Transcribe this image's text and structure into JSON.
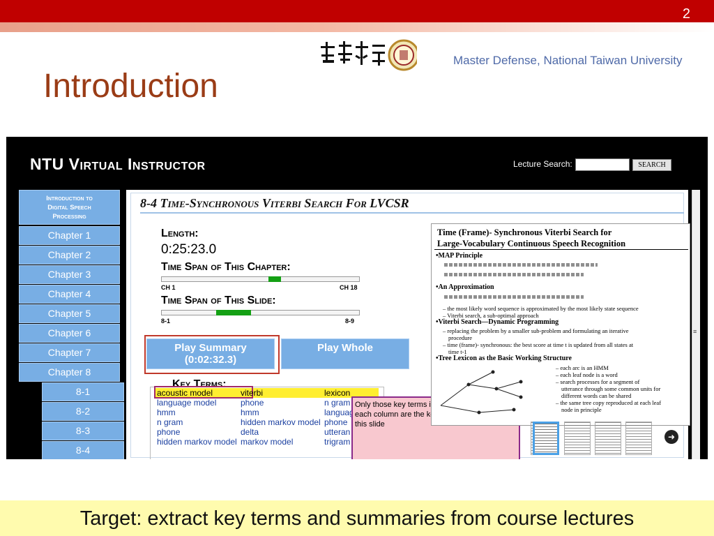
{
  "slide": {
    "number": "2",
    "header_text": "Master Defense, National Taiwan University",
    "title": "Introduction",
    "target_text": "Target: extract key terms and summaries from course lectures"
  },
  "app": {
    "title": "NTU Virtual Instructor",
    "search_label": "Lecture Search:",
    "search_button": "SEARCH"
  },
  "sidebar": {
    "intro_lines": [
      "Introduction to",
      "Digital Speech",
      "Processing"
    ],
    "chapters": [
      "Chapter 1",
      "Chapter 2",
      "Chapter 3",
      "Chapter 4",
      "Chapter 5",
      "Chapter 6",
      "Chapter 7",
      "Chapter 8"
    ],
    "subsections": [
      "8-1",
      "8-2",
      "8-3",
      "8-4"
    ]
  },
  "main": {
    "heading": "8-4 Time-Synchronous Viterbi Search For LVCSR",
    "length_label": "Length:",
    "length_value": "0:25:23.0",
    "chapter_span_label": "Time Span of This Chapter:",
    "chapter_span_start": "CH 1",
    "chapter_span_end": "CH 18",
    "slide_span_label": "Time Span of This Slide:",
    "slide_span_start": "8-1",
    "slide_span_end": "8-9",
    "play_summary_line1": "Play Summary",
    "play_summary_line2": "(0:02:32.3)",
    "play_whole": "Play Whole",
    "key_terms_label": "Key Terms:",
    "key_terms_columns": [
      [
        "acoustic model",
        "language model",
        "hmm",
        "n gram",
        "phone",
        "hidden markov model"
      ],
      [
        "viterbi",
        "phone",
        "hmm",
        "hidden markov model",
        "delta",
        "markov model"
      ],
      [
        "lexicon",
        "n gram",
        "languag",
        "phone",
        "utteran",
        "trigram"
      ]
    ],
    "note": "Only those key terms in black on the top of each column are the key terms appearing in this slide"
  },
  "lecture_slide": {
    "title_line1": "Time (Frame)- Synchronous Viterbi Search for",
    "title_line2": "Large-Vocabulary Continuous Speech Recognition",
    "lines": [
      "•MAP Principle",
      "•An Approximation",
      "– the most likely word sequence is approximated by the most likely state sequence",
      "– Viterbi search, a sub-optimal approach",
      "•Viterbi Search—Dynamic Programming",
      "– replacing the problem by a smaller sub-problem and formulating an iterative",
      "procedure",
      "– time (frame)- synchronous: the best score at time t is updated from all states at",
      "time t-1",
      "•Tree Lexicon as the Basic Working Structure",
      "– each arc is an HMM",
      "– each leaf node is a word",
      "– search processes for a segment of",
      "utterance through some common units for",
      "different words can be shared",
      "– the same tree copy reproduced at each leaf",
      "node in principle"
    ]
  },
  "progress": {
    "chapter_marker": 0.58,
    "slide_marker": 0.4
  },
  "colors": {
    "top_bar": "#c00000",
    "title": "#9a3c16",
    "header_text": "#4f6aa8",
    "nav_blue": "#78aee4",
    "progress_green": "#14a014",
    "target_band": "#fffbae",
    "note_bg": "#f8c8cf",
    "note_border": "#8a2a8a",
    "highlight_yellow": "#ffee30"
  }
}
